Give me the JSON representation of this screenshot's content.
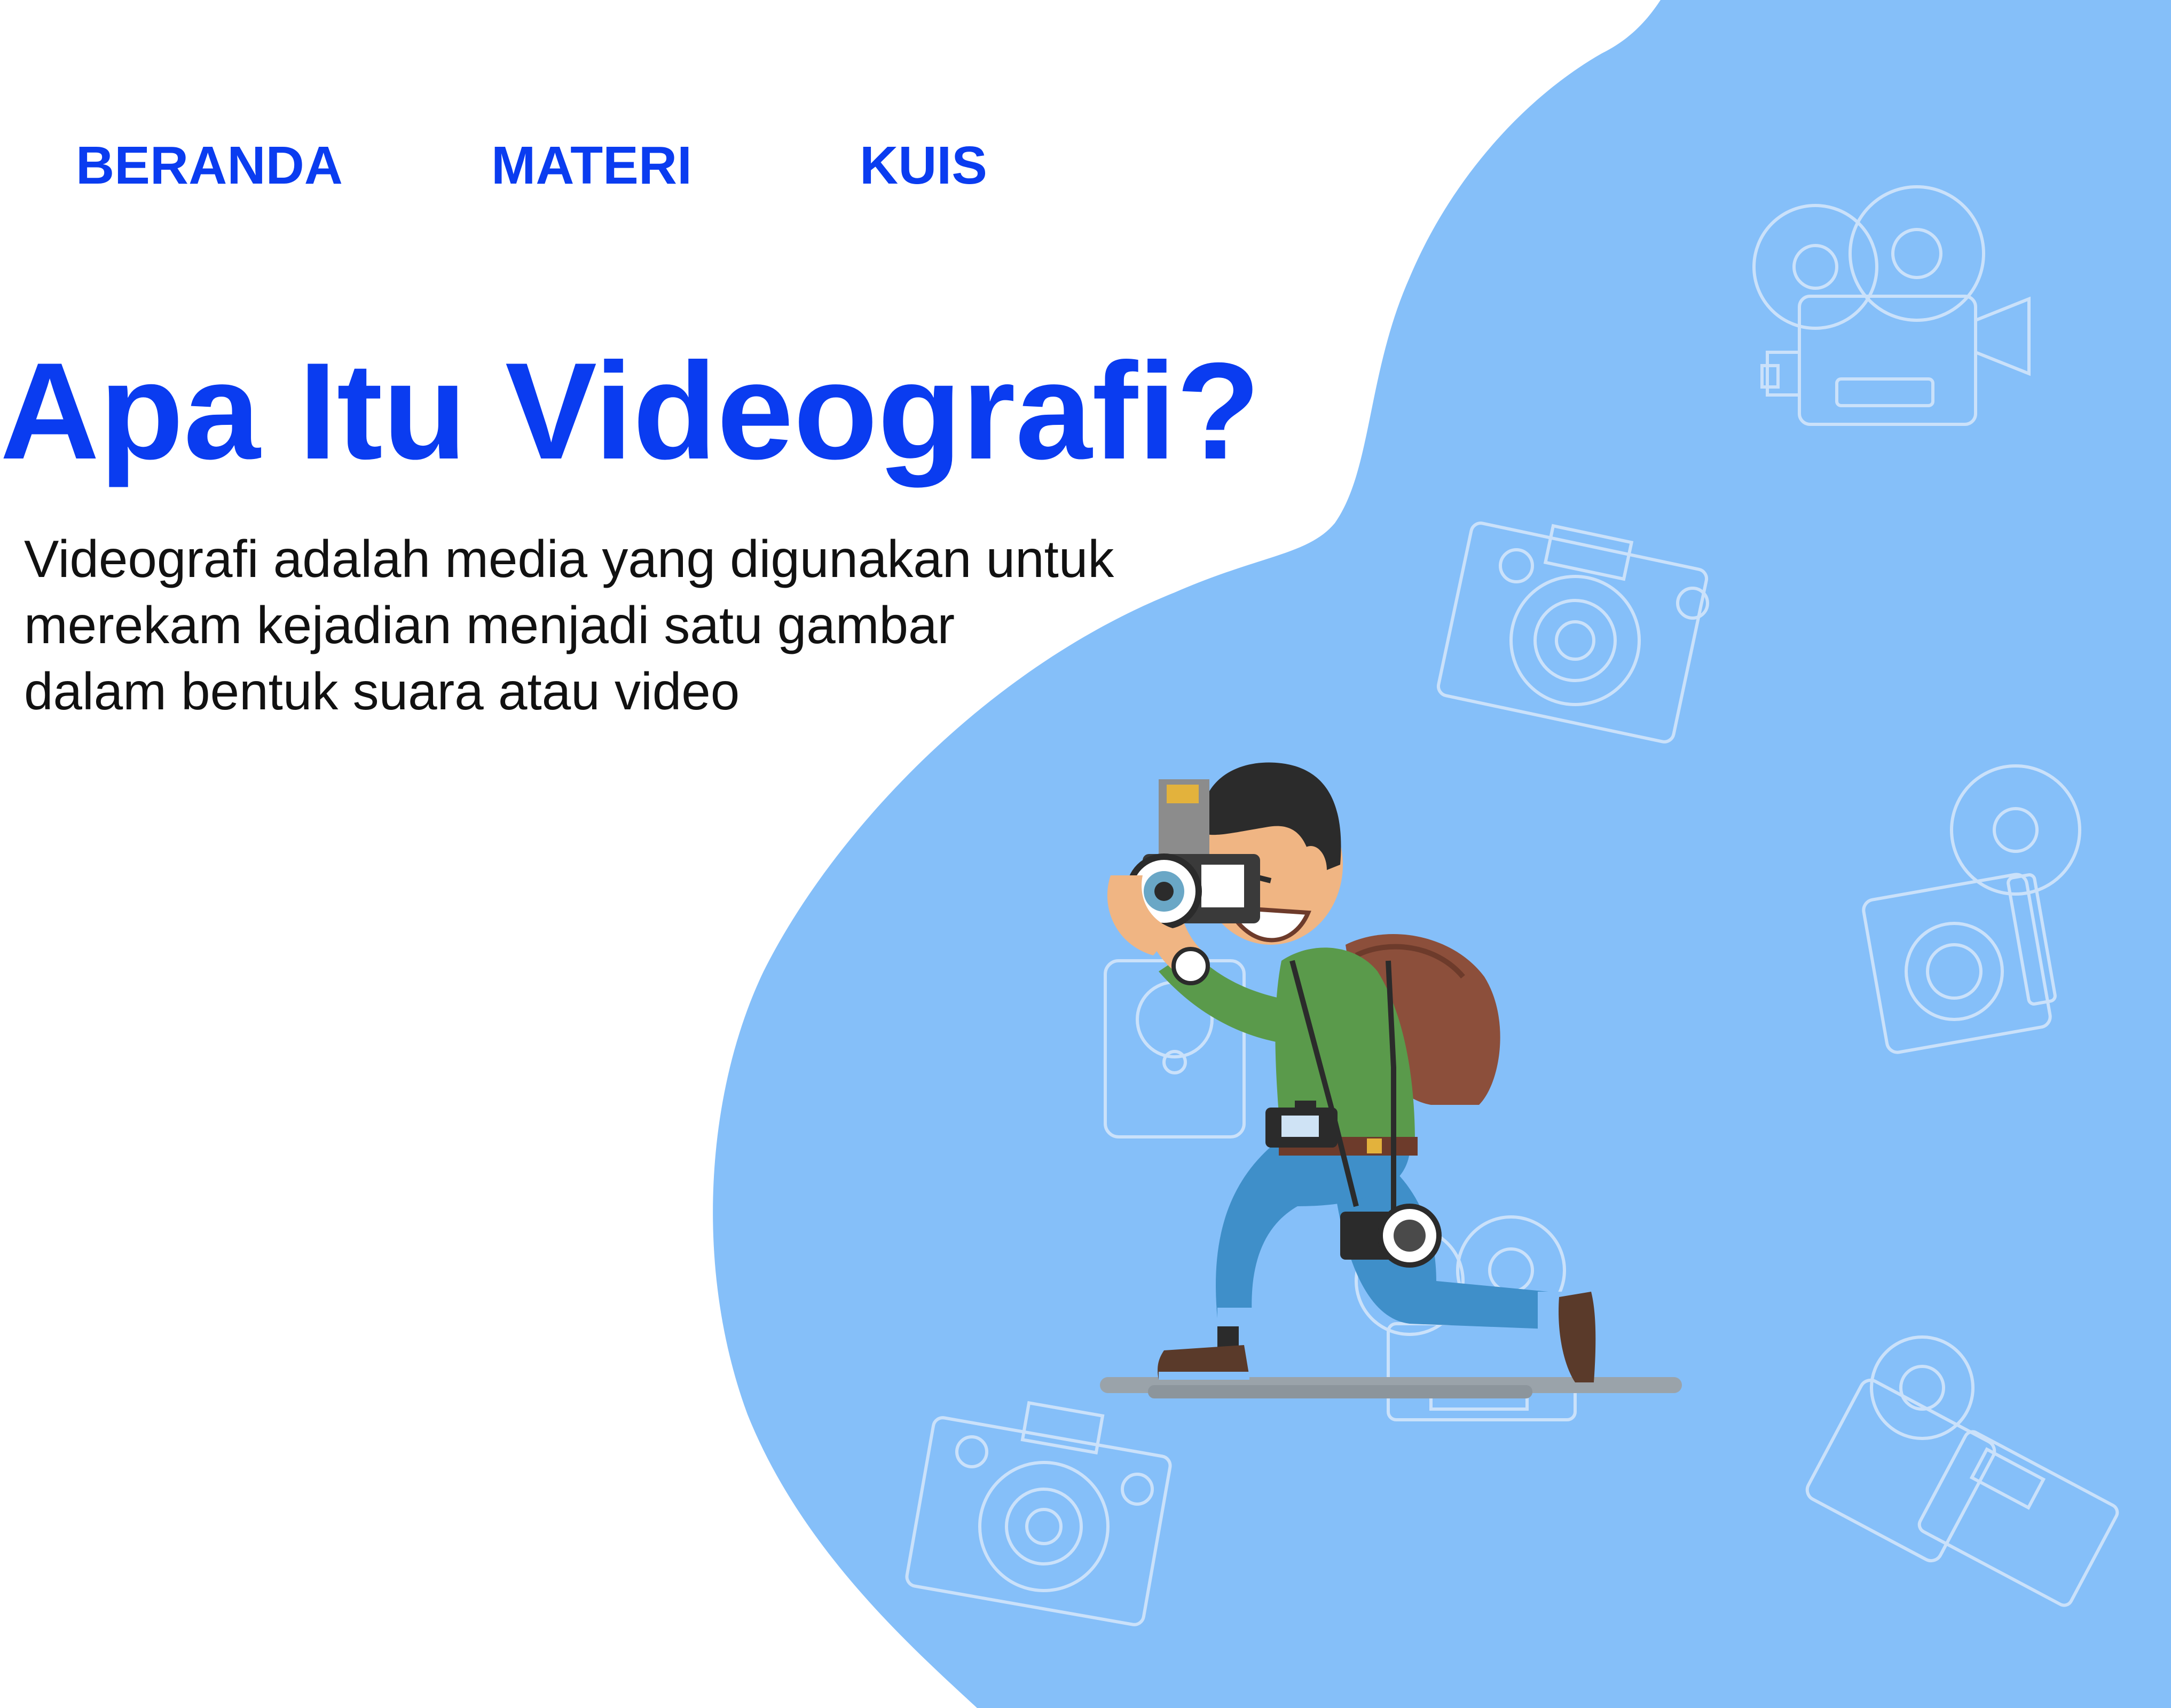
{
  "nav": {
    "items": [
      {
        "label": "BERANDA"
      },
      {
        "label": "MATERI"
      },
      {
        "label": "KUIS"
      }
    ]
  },
  "hero": {
    "title": "Apa Itu Videografi?",
    "description_lines": [
      "Videografi adalah media yang digunakan untuk",
      "merekam kejadian menjadi satu gambar",
      "dalam bentuk suara atau video"
    ]
  },
  "colors": {
    "accent": "#0a3cf0",
    "blob": "#85bff9",
    "text": "#111111",
    "background": "#ffffff"
  },
  "icons": [
    "film-camera-icon",
    "camera-icon",
    "instant-camera-icon",
    "camcorder-icon",
    "photographer-illustration"
  ]
}
